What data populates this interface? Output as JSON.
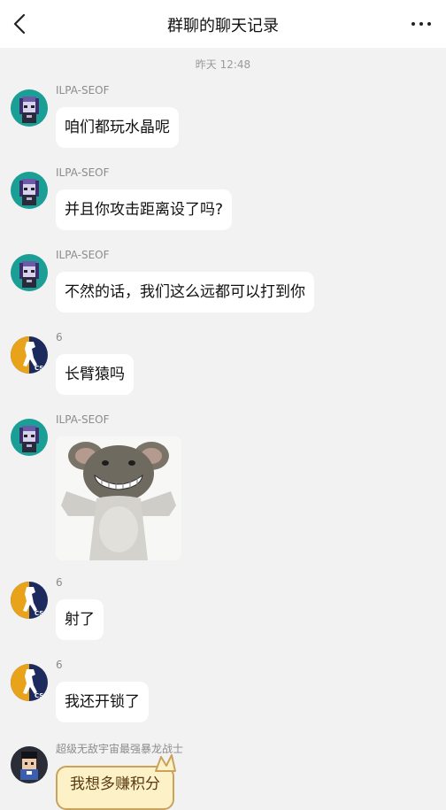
{
  "header": {
    "title": "群聊的聊天记录"
  },
  "timestamp": "昨天 12:48",
  "messages": [
    {
      "sender": "ILPA-SEOF",
      "avatar": "teal-pixel-avatar",
      "text": "咱们都玩水晶呢"
    },
    {
      "sender": "ILPA-SEOF",
      "avatar": "teal-pixel-avatar",
      "text": "并且你攻击距离设了吗?"
    },
    {
      "sender": "ILPA-SEOF",
      "avatar": "teal-pixel-avatar",
      "text": "不然的话，我们这么远都可以打到你"
    },
    {
      "sender": "6",
      "avatar": "csgo-logo-avatar",
      "text": "长臂猿吗"
    },
    {
      "sender": "ILPA-SEOF",
      "avatar": "teal-pixel-avatar",
      "sticker": "grinning-mouse-sticker"
    },
    {
      "sender": "6",
      "avatar": "csgo-logo-avatar",
      "text": "射了"
    },
    {
      "sender": "6",
      "avatar": "csgo-logo-avatar",
      "text": "我还开锁了"
    },
    {
      "sender": "超级无敌宇宙最强暴龙战士",
      "avatar": "dark-pixel-avatar",
      "text": "我想多赚积分"
    }
  ],
  "colors": {
    "background": "#f2f2f2",
    "bubble": "#ffffff",
    "teal_avatar": "#1a9e96",
    "csgo_gold": "#e8a31b",
    "csgo_navy": "#1d2a5e"
  }
}
